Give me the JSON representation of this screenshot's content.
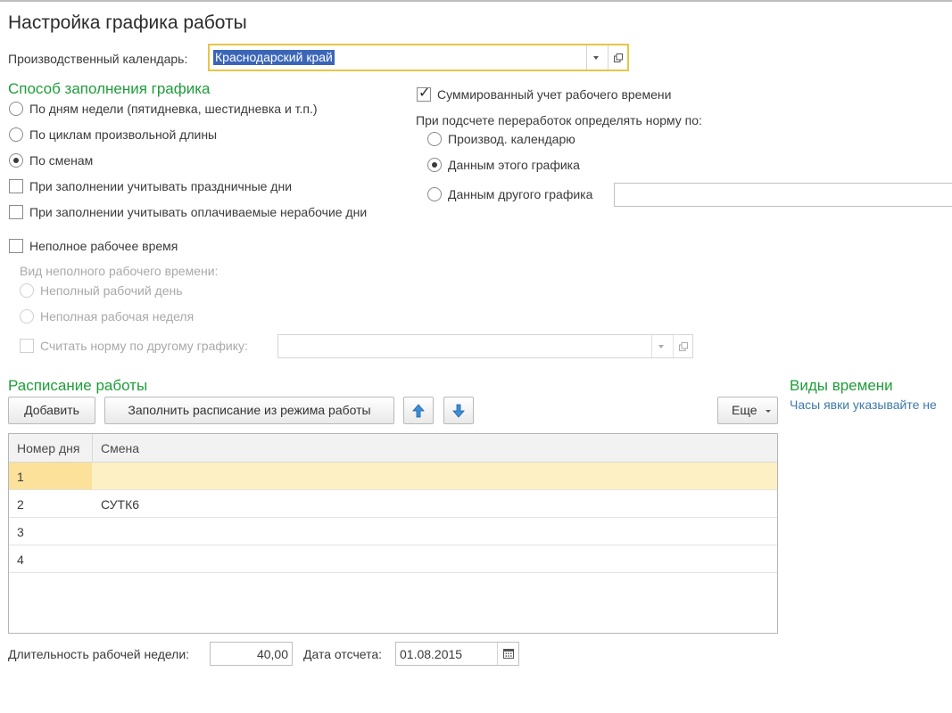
{
  "title": "Настройка графика работы",
  "calendar": {
    "label": "Производственный календарь:",
    "value": "Краснодарский край"
  },
  "fill_method": {
    "heading": "Способ заполнения графика",
    "options": [
      {
        "label": "По дням недели (пятидневка, шестидневка и т.п.)",
        "selected": false
      },
      {
        "label": "По циклам произвольной длины",
        "selected": false
      },
      {
        "label": "По сменам",
        "selected": true
      }
    ],
    "consider_holidays": {
      "label": "При заполнении учитывать праздничные дни",
      "checked": false
    },
    "consider_paid_nonworking": {
      "label": "При заполнении учитывать оплачиваемые нерабочие дни",
      "checked": false
    }
  },
  "summarized": {
    "label": "Суммированный учет рабочего времени",
    "checked": true
  },
  "overtime": {
    "label": "При подсчете переработок определять норму по:",
    "options": [
      {
        "label": "Производ. календарю",
        "selected": false
      },
      {
        "label": "Данным этого графика",
        "selected": true
      },
      {
        "label": "Данным другого графика",
        "selected": false
      }
    ],
    "other_schedule_value": ""
  },
  "part_time": {
    "label": "Неполное рабочее время",
    "checked": false,
    "type_label": "Вид неполного рабочего времени:",
    "options": [
      {
        "label": "Неполный рабочий день"
      },
      {
        "label": "Неполная рабочая неделя"
      }
    ],
    "norm_other": {
      "label": "Считать норму по другому графику:",
      "value": ""
    }
  },
  "schedule": {
    "heading": "Расписание работы",
    "buttons": {
      "add": "Добавить",
      "fill": "Заполнить расписание из режима работы",
      "more": "Еще"
    },
    "columns": [
      "Номер дня",
      "Смена"
    ],
    "rows": [
      {
        "day": "1",
        "shift": ""
      },
      {
        "day": "2",
        "shift": "СУТК6"
      },
      {
        "day": "3",
        "shift": ""
      },
      {
        "day": "4",
        "shift": ""
      }
    ]
  },
  "time_types": {
    "heading": "Виды времени",
    "note": "Часы явки указывайте не"
  },
  "week_length": {
    "label": "Длительность рабочей недели:",
    "value": "40,00"
  },
  "ref_date": {
    "label": "Дата отсчета:",
    "value": "01.08.2015"
  },
  "colors": {
    "accent_green": "#1f9d3a",
    "focus_yellow": "#e8c547",
    "selection_blue": "#3b66b8",
    "row_highlight": "#fdf0c4",
    "link_blue": "#3d7aa8"
  }
}
